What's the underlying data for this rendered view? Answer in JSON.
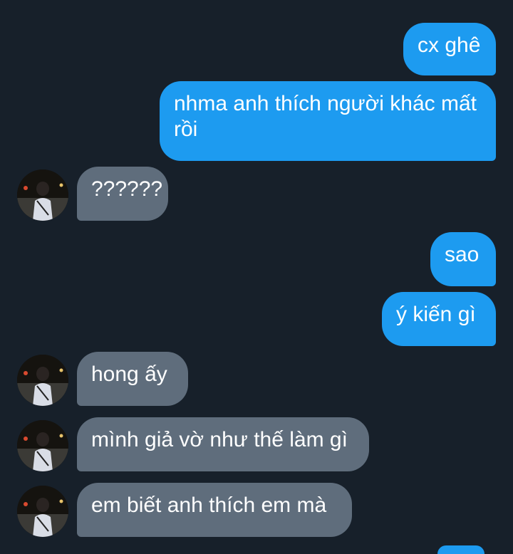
{
  "colors": {
    "background": "#17202a",
    "outgoing_bubble": "#1d9bf0",
    "incoming_bubble": "#5f6d7c",
    "text": "#ffffff"
  },
  "messages": [
    {
      "side": "outgoing",
      "text": "cx ghê"
    },
    {
      "side": "outgoing",
      "text": "nhma anh thích người khác mất rồi"
    },
    {
      "side": "incoming",
      "text": "??????",
      "avatar": "profile-photo"
    },
    {
      "side": "outgoing",
      "text": "sao"
    },
    {
      "side": "outgoing",
      "text": "ý kiến gì"
    },
    {
      "side": "incoming",
      "text": "hong ấy",
      "avatar": "profile-photo"
    },
    {
      "side": "incoming",
      "text": "mình giả vờ như thế làm gì",
      "avatar": "profile-photo"
    },
    {
      "side": "incoming",
      "text": "em biết anh thích em mà",
      "avatar": "profile-photo"
    }
  ]
}
